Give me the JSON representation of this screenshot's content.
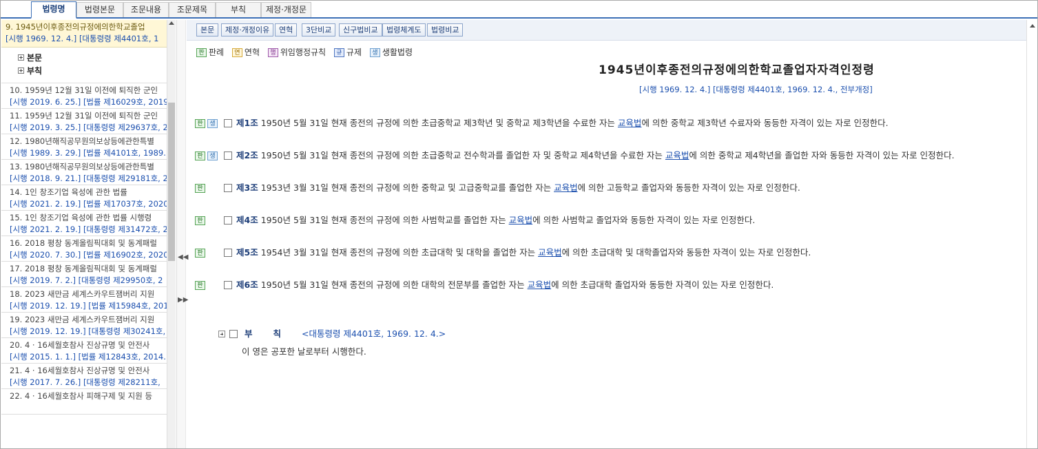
{
  "tabs": [
    "법령명",
    "법령본문",
    "조문내용",
    "조문제목",
    "부칙",
    "제정·개정문"
  ],
  "left": {
    "selected": {
      "title": "9.   1945년이후종전의규정에의한학교졸업",
      "info": "[시행 1969. 12. 4.] [대통령령 제4401호, 1"
    },
    "tree": [
      "본문",
      "부칙"
    ],
    "items": [
      {
        "title": "10.   1959년 12월 31일 이전에 퇴직한 군인",
        "info": "[시행 2019. 6. 25.] [법률 제16029호, 2019"
      },
      {
        "title": "11.   1959년 12월 31일 이전에 퇴직한 군인",
        "info": "[시행 2019. 3. 25.] [대통령령 제29637호, 2"
      },
      {
        "title": "12.   1980년해직공무원의보상등에관한특별",
        "info": "[시행 1989. 3. 29.] [법률 제4101호, 1989."
      },
      {
        "title": "13.   1980년해직공무원의보상등에관한특별",
        "info": "[시행 2018. 9. 21.] [대통령령 제29181호, 2"
      },
      {
        "title": "14.   1인 창조기업 육성에 관한 법률",
        "info": "[시행 2021. 2. 19.] [법률 제17037호, 2020"
      },
      {
        "title": "15.   1인 창조기업 육성에 관한 법률 시행령",
        "info": "[시행 2021. 2. 19.] [대통령령 제31472호, 2"
      },
      {
        "title": "16.   2018 평창 동계올림픽대회 및 동계패럴",
        "info": "[시행 2020. 7. 30.] [법률 제16902호, 2020"
      },
      {
        "title": "17.   2018 평창 동계올림픽대회 및 동계패럴",
        "info": "[시행 2019. 7. 2.] [대통령령 제29950호, 2"
      },
      {
        "title": "18.   2023 새만금 세계스카우트잼버리 지원",
        "info": "[시행 2019. 12. 19.] [법률 제15984호, 201"
      },
      {
        "title": "19.   2023 새만금 세계스카우트잼버리 지원",
        "info": "[시행 2019. 12. 19.] [대통령령 제30241호,"
      },
      {
        "title": "20.   4 · 16세월호참사 진상규명 및 안전사",
        "info": "[시행 2015. 1. 1.] [법률 제12843호, 2014."
      },
      {
        "title": "21.   4 · 16세월호참사 진상규명 및 안전사",
        "info": "[시행 2017. 7. 26.] [대통령령 제28211호,"
      },
      {
        "title": "22.   4 · 16세월호참사 피해구제 및 지원 등",
        "info": ""
      }
    ]
  },
  "toolbar": [
    "본문",
    "제정·개정이유",
    "연혁",
    "3단비교",
    "신구법비교",
    "법령체계도",
    "법령비교"
  ],
  "legend": [
    {
      "icon": "판",
      "label": "판례",
      "cls": "ic-pan"
    },
    {
      "icon": "연",
      "label": "연혁",
      "cls": "ic-yeon"
    },
    {
      "icon": "행",
      "label": "위임행정규칙",
      "cls": "ic-haeng"
    },
    {
      "icon": "규",
      "label": "규제",
      "cls": "ic-gyu"
    },
    {
      "icon": "생",
      "label": "생활법령",
      "cls": "ic-saeng"
    }
  ],
  "law": {
    "title": "1945년이후종전의규정에의한학교졸업자자격인정령",
    "info": "[시행 1969. 12. 4.] [대통령령 제4401호, 1969. 12. 4., 전부개정]"
  },
  "articles": [
    {
      "no": "제1조",
      "icons": [
        "판",
        "생"
      ],
      "pre": "1950년 5월 31일 현재 종전의 규정에 의한 초급중학교 제3학년 및 중학교 제3학년을 수료한 자는 ",
      "link": "교육법",
      "post": "에 의한 중학교 제3학년 수료자와 동등한 자격이 있는 자로 인정한다."
    },
    {
      "no": "제2조",
      "icons": [
        "판",
        "생"
      ],
      "pre": "1950년 5월 31일 현재 종전의 규정에 의한 초급중학교 전수학과를 졸업한 자 및 중학교 제4학년을 수료한 자는 ",
      "link": "교육법",
      "post": "에 의한 중학교 제4학년을 졸업한 자와 동등한 자격이 있는 자로 인정한다."
    },
    {
      "no": "제3조",
      "icons": [
        "판"
      ],
      "pre": "1953년 3월 31일 현재 종전의 규정에 의한 중학교 및 고급중학교를 졸업한 자는 ",
      "link": "교육법",
      "post": "에 의한 고등학교 졸업자와 동등한 자격이 있는 자로 인정한다."
    },
    {
      "no": "제4조",
      "icons": [
        "판"
      ],
      "pre": "1950년 5월 31일 현재 종전의 규정에 의한 사범학교를 졸업한 자는 ",
      "link": "교육법",
      "post": "에 의한 사범학교 졸업자와 동등한 자격이 있는 자로 인정한다."
    },
    {
      "no": "제5조",
      "icons": [
        "판"
      ],
      "pre": "1954년 3월 31일 현재 종전의 규정에 의한 초급대학 및 대학을 졸업한 자는 ",
      "link": "교육법",
      "post": "에 의한 초급대학 및 대학졸업자와 동등한 자격이 있는 자로 인정한다."
    },
    {
      "no": "제6조",
      "icons": [
        "판"
      ],
      "pre": "1950년 5월 31일 현재 종전의 규정에 의한 대학의 전문부를 졸업한 자는 ",
      "link": "교육법",
      "post": "에 의한 초급대학 졸업자와 동등한 자격이 있는 자로 인정한다."
    }
  ],
  "buchik": {
    "label": "부칙",
    "ref": "<대통령령 제4401호, 1969. 12. 4.>",
    "body": "이 영은 공포한 날로부터 시행한다."
  },
  "splitter": {
    "collapse": "◀◀",
    "expand": "▶▶"
  }
}
